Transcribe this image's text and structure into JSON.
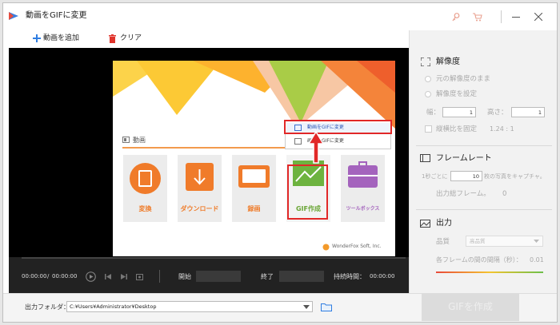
{
  "window": {
    "title": "動画をGIFに変更"
  },
  "toolbar": {
    "add_video": "動画を追加",
    "clear": "クリア"
  },
  "app": {
    "section_label": "動画",
    "cards": [
      {
        "label": "変換"
      },
      {
        "label": "ダウンロード"
      },
      {
        "label": "録画"
      },
      {
        "label": "GIF作成"
      },
      {
        "label": "ツールボックス"
      }
    ],
    "menu_items": [
      "動画をGIFに変更",
      "画像をGIFに変更"
    ],
    "brand": "WonderFox Soft, Inc."
  },
  "player": {
    "current_time": "00:00:00",
    "separator": "/",
    "total_time": "00:00:00",
    "start_label": "開始",
    "end_label": "終了",
    "duration_label": "持続時間：",
    "duration_value": "00:00:00"
  },
  "output": {
    "folder_label": "出力フォルダ：",
    "folder_path": "C:¥Users¥Administrator¥Desktop",
    "create_button": "GIFを作成"
  },
  "settings": {
    "resolution": {
      "title": "解像度",
      "option_original": "元の解像度のまま",
      "option_custom": "解像度を設定",
      "width_label": "幅：",
      "width_value": "1",
      "height_label": "高さ：",
      "height_value": "1",
      "keep_ratio_label": "縦横比を固定",
      "ratio_value": "1.24 : 1"
    },
    "framerate": {
      "title": "フレームレート",
      "prefix": "1秒ごとに",
      "value": "10",
      "suffix": "枚の写真をキャプチャ。",
      "output_label": "出力総フレーム。",
      "output_value": "0"
    },
    "output": {
      "title": "出力",
      "quality_label": "品質",
      "quality_value": "高品質",
      "interval_label": "各フレームの間の間隔（秒）：",
      "interval_value": "0.01"
    }
  }
}
